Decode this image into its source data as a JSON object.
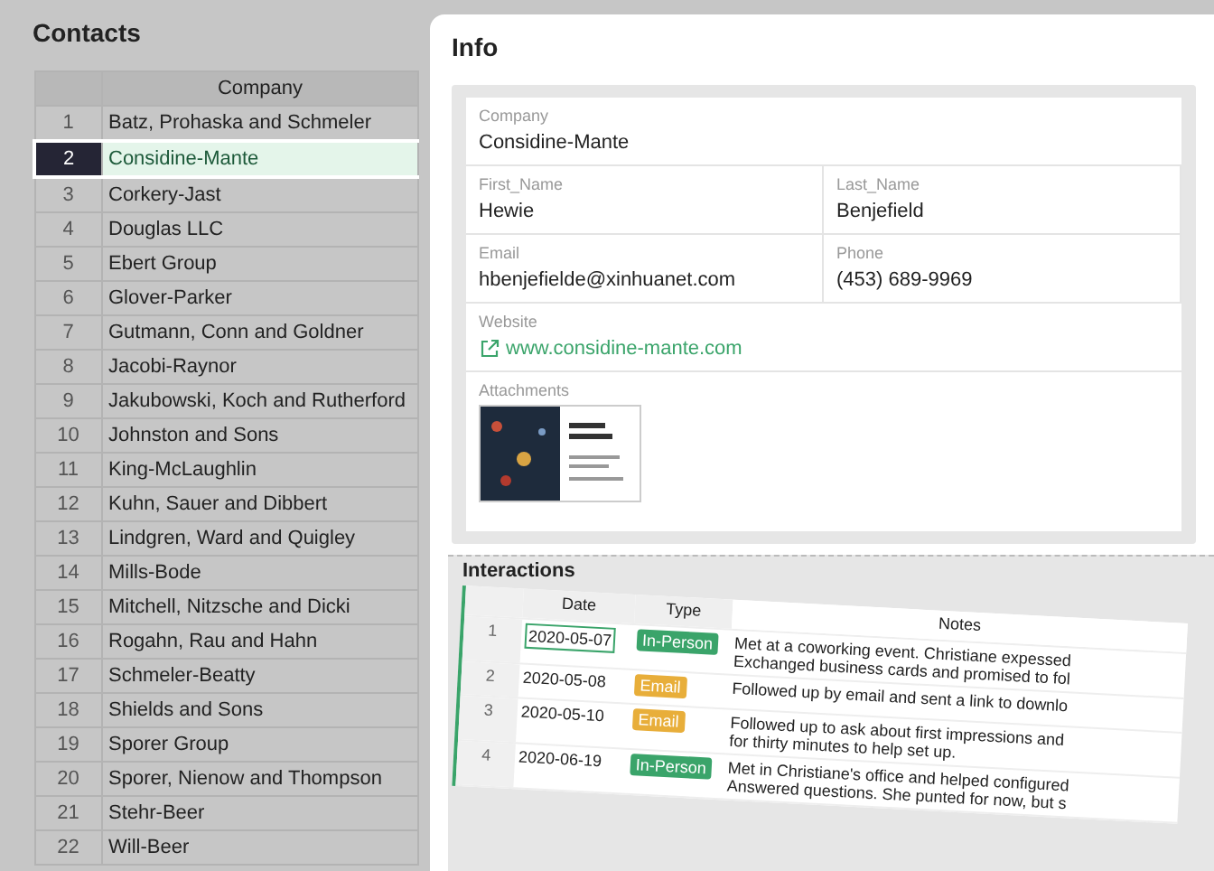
{
  "contacts": {
    "title": "Contacts",
    "column": "Company",
    "rows": [
      {
        "num": "1",
        "company": "Batz, Prohaska and Schmeler",
        "selected": false
      },
      {
        "num": "2",
        "company": "Considine-Mante",
        "selected": true
      },
      {
        "num": "3",
        "company": "Corkery-Jast",
        "selected": false
      },
      {
        "num": "4",
        "company": "Douglas LLC",
        "selected": false
      },
      {
        "num": "5",
        "company": "Ebert Group",
        "selected": false
      },
      {
        "num": "6",
        "company": "Glover-Parker",
        "selected": false
      },
      {
        "num": "7",
        "company": "Gutmann, Conn and Goldner",
        "selected": false
      },
      {
        "num": "8",
        "company": "Jacobi-Raynor",
        "selected": false
      },
      {
        "num": "9",
        "company": "Jakubowski, Koch and Rutherford",
        "selected": false
      },
      {
        "num": "10",
        "company": "Johnston and Sons",
        "selected": false
      },
      {
        "num": "11",
        "company": "King-McLaughlin",
        "selected": false
      },
      {
        "num": "12",
        "company": "Kuhn, Sauer and Dibbert",
        "selected": false
      },
      {
        "num": "13",
        "company": "Lindgren, Ward and Quigley",
        "selected": false
      },
      {
        "num": "14",
        "company": "Mills-Bode",
        "selected": false
      },
      {
        "num": "15",
        "company": "Mitchell, Nitzsche and Dicki",
        "selected": false
      },
      {
        "num": "16",
        "company": "Rogahn, Rau and Hahn",
        "selected": false
      },
      {
        "num": "17",
        "company": "Schmeler-Beatty",
        "selected": false
      },
      {
        "num": "18",
        "company": "Shields and Sons",
        "selected": false
      },
      {
        "num": "19",
        "company": "Sporer Group",
        "selected": false
      },
      {
        "num": "20",
        "company": "Sporer, Nienow and Thompson",
        "selected": false
      },
      {
        "num": "21",
        "company": "Stehr-Beer",
        "selected": false
      },
      {
        "num": "22",
        "company": "Will-Beer",
        "selected": false
      }
    ]
  },
  "info": {
    "title": "Info",
    "company": {
      "label": "Company",
      "value": "Considine-Mante"
    },
    "first_name": {
      "label": "First_Name",
      "value": "Hewie"
    },
    "last_name": {
      "label": "Last_Name",
      "value": "Benjefield"
    },
    "email": {
      "label": "Email",
      "value": "hbenjefielde@xinhuanet.com"
    },
    "phone": {
      "label": "Phone",
      "value": "(453) 689-9969"
    },
    "website": {
      "label": "Website",
      "value": "www.considine-mante.com"
    },
    "attachments": {
      "label": "Attachments"
    }
  },
  "interactions": {
    "title": "Interactions",
    "columns": [
      "Date",
      "Type",
      "Notes"
    ],
    "rows": [
      {
        "num": "1",
        "date": "2020-05-07",
        "type": "In-Person",
        "color": "#3aa46a",
        "notes": [
          "Met at a coworking event. Christiane expessed",
          "Exchanged business cards and promised to fol"
        ]
      },
      {
        "num": "2",
        "date": "2020-05-08",
        "type": "Email",
        "color": "#e8ae3a",
        "notes": [
          "Followed up by email and sent a link to downlo"
        ]
      },
      {
        "num": "3",
        "date": "2020-05-10",
        "type": "Email",
        "color": "#e8ae3a",
        "notes": [
          "Followed up to ask about first impressions and",
          "for thirty minutes to help set up."
        ]
      },
      {
        "num": "4",
        "date": "2020-06-19",
        "type": "In-Person",
        "color": "#3aa46a",
        "notes": [
          "Met in Christiane's office and helped configured",
          "Answered questions. She punted for now, but s"
        ]
      }
    ]
  }
}
